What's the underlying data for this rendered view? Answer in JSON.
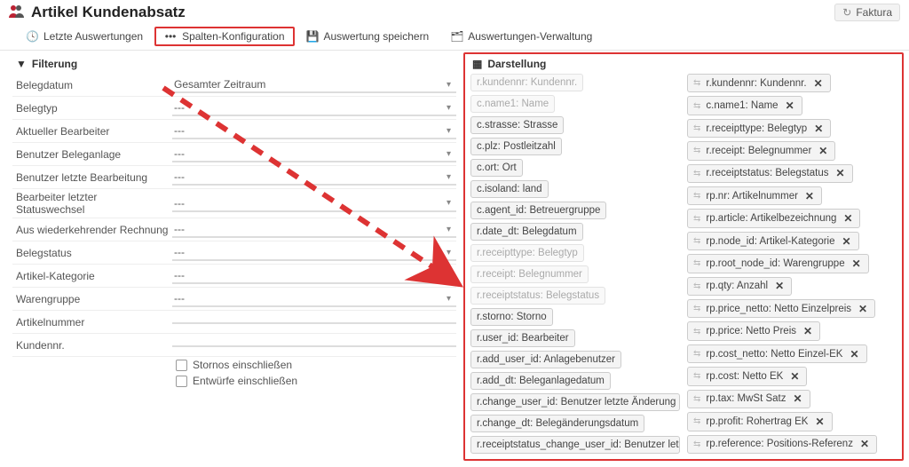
{
  "header": {
    "page_title": "Artikel Kundenabsatz",
    "faktura": "Faktura"
  },
  "toolbar": {
    "last": "Letzte Auswertungen",
    "columns": "Spalten-Konfiguration",
    "save": "Auswertung speichern",
    "manage": "Auswertungen-Verwaltung"
  },
  "filter": {
    "title": "Filterung",
    "rows": {
      "belegdatum": {
        "label": "Belegdatum",
        "value": "Gesamter Zeitraum"
      },
      "belegtyp": {
        "label": "Belegtyp",
        "value": "---"
      },
      "bearbeiter": {
        "label": "Aktueller Bearbeiter",
        "value": "---"
      },
      "benutzer_anlage": {
        "label": "Benutzer Beleganlage",
        "value": "---"
      },
      "benutzer_bearb": {
        "label": "Benutzer letzte Bearbeitung",
        "value": "---"
      },
      "bearbeiter_status": {
        "label": "Bearbeiter letzter Statuswechsel",
        "value": "---"
      },
      "wiederkehrend": {
        "label": "Aus wiederkehrender Rechnung",
        "value": "---"
      },
      "belegstatus": {
        "label": "Belegstatus",
        "value": "---"
      },
      "artikel_kat": {
        "label": "Artikel-Kategorie",
        "value": "---"
      },
      "warengruppe": {
        "label": "Warengruppe",
        "value": "---"
      },
      "artikelnummer": {
        "label": "Artikelnummer",
        "value": ""
      },
      "kundennr": {
        "label": "Kundennr.",
        "value": ""
      }
    },
    "chk_stornos": "Stornos einschließen",
    "chk_entwuerfe": "Entwürfe einschließen"
  },
  "darstellung": {
    "title": "Darstellung",
    "available": [
      {
        "label": "r.kundennr: Kundennr.",
        "disabled": true
      },
      {
        "label": "c.name1: Name",
        "disabled": true
      },
      {
        "label": "c.strasse: Strasse",
        "disabled": false
      },
      {
        "label": "c.plz: Postleitzahl",
        "disabled": false
      },
      {
        "label": "c.ort: Ort",
        "disabled": false
      },
      {
        "label": "c.isoland: land",
        "disabled": false
      },
      {
        "label": "c.agent_id: Betreuergruppe",
        "disabled": false
      },
      {
        "label": "r.date_dt: Belegdatum",
        "disabled": false
      },
      {
        "label": "r.receipttype: Belegtyp",
        "disabled": true
      },
      {
        "label": "r.receipt: Belegnummer",
        "disabled": true
      },
      {
        "label": "r.receiptstatus: Belegstatus",
        "disabled": true
      },
      {
        "label": "r.storno: Storno",
        "disabled": false
      },
      {
        "label": "r.user_id: Bearbeiter",
        "disabled": false
      },
      {
        "label": "r.add_user_id: Anlagebenutzer",
        "disabled": false
      },
      {
        "label": "r.add_dt: Beleganlagedatum",
        "disabled": false
      },
      {
        "label": "r.change_user_id: Benutzer letzte Änderung",
        "disabled": false
      },
      {
        "label": "r.change_dt: Belegänderungsdatum",
        "disabled": false
      },
      {
        "label": "r.receiptstatus_change_user_id: Benutzer letzte",
        "disabled": false
      }
    ],
    "selected": [
      {
        "label": "r.kundennr: Kundennr."
      },
      {
        "label": "c.name1: Name"
      },
      {
        "label": "r.receipttype: Belegtyp"
      },
      {
        "label": "r.receipt: Belegnummer"
      },
      {
        "label": "r.receiptstatus: Belegstatus"
      },
      {
        "label": "rp.nr: Artikelnummer"
      },
      {
        "label": "rp.article: Artikelbezeichnung"
      },
      {
        "label": "rp.node_id: Artikel-Kategorie"
      },
      {
        "label": "rp.root_node_id: Warengruppe"
      },
      {
        "label": "rp.qty: Anzahl"
      },
      {
        "label": "rp.price_netto: Netto Einzelpreis"
      },
      {
        "label": "rp.price: Netto Preis"
      },
      {
        "label": "rp.cost_netto: Netto Einzel-EK"
      },
      {
        "label": "rp.cost: Netto EK"
      },
      {
        "label": "rp.tax: MwSt Satz"
      },
      {
        "label": "rp.profit: Rohertrag EK"
      },
      {
        "label": "rp.reference: Positions-Referenz"
      }
    ]
  }
}
